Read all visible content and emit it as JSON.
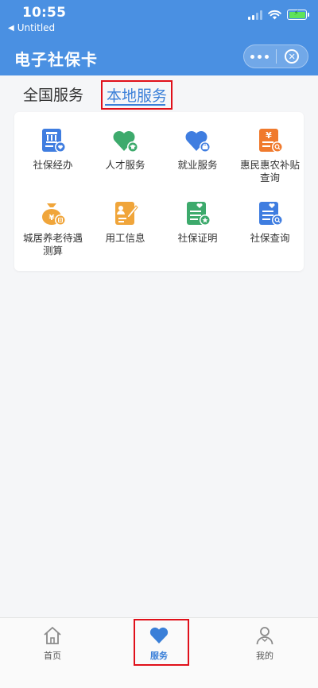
{
  "status_bar": {
    "time": "10:55",
    "back_label": "Untitled"
  },
  "header": {
    "title": "电子社保卡",
    "more_icon": "more-dots-icon",
    "close_icon": "close-circle-icon"
  },
  "tabs": [
    {
      "label": "全国服务",
      "selected": false
    },
    {
      "label": "本地服务",
      "selected": true
    }
  ],
  "services": [
    {
      "label": "社保经办",
      "icon": "social-security-handling-icon"
    },
    {
      "label": "人才服务",
      "icon": "talent-service-icon"
    },
    {
      "label": "就业服务",
      "icon": "employment-service-icon"
    },
    {
      "label": "惠民惠农补贴查询",
      "label_line1": "惠民惠农补贴",
      "label_line2": "查询",
      "icon": "subsidy-query-icon"
    },
    {
      "label": "城居养老待遇测算",
      "label_line1": "城居养老待遇",
      "label_line2": "测算",
      "icon": "pension-calculation-icon"
    },
    {
      "label": "用工信息",
      "icon": "employment-info-icon"
    },
    {
      "label": "社保证明",
      "icon": "social-security-certificate-icon"
    },
    {
      "label": "社保查询",
      "icon": "social-security-query-icon"
    }
  ],
  "tabbar": [
    {
      "label": "首页",
      "icon": "home-icon",
      "active": false
    },
    {
      "label": "服务",
      "icon": "heart-icon",
      "active": true
    },
    {
      "label": "我的",
      "icon": "user-icon",
      "active": false
    }
  ],
  "colors": {
    "header_bg": "#4a90e2",
    "accent": "#3a7fd8",
    "highlight_box": "#e0101a"
  }
}
